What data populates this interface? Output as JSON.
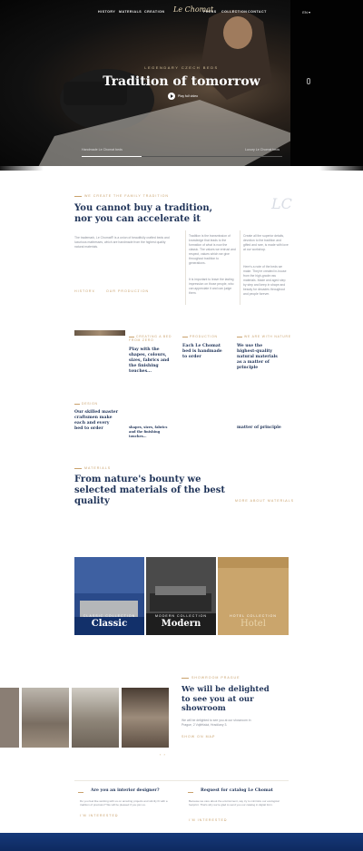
{
  "nav": {
    "items": [
      "HISTORY",
      "MATERIALS",
      "CREATION",
      "PRESS",
      "COLLECTION",
      "CONTACT"
    ],
    "logo": "Le Chomat",
    "language": "EN"
  },
  "hero": {
    "kicker": "LEGENDARY CZECH BEDS",
    "title": "Tradition of tomorrow",
    "play_label": "Play full video",
    "slide_left": "Handmade Le Chomat beds",
    "slide_right": "Luxury Le Chomat beds",
    "progress_fraction": 0.3
  },
  "intro": {
    "eyebrow": "WE CREATE THE FAMILY TRADITION",
    "title_line1": "You cannot buy a tradition,",
    "title_line2": "nor you can accelerate it",
    "lead": "The trademark, Le Chomat® is a union of beautifully crafted beds and luxurious mattresses, which are handmade from the highest quality natural materials.",
    "col2": "Tradition is the transmission of knowledge that leads to the formation of what is now the classic. The values we entrust and respect, values which we give throughout tradition to generations.",
    "col2b": "It is important to leave the lasting impression on those people, who can appreciate it and can judge them.",
    "col3": "Create all the superior details, devotion to the tradition and gifted and rare, is made with love at our workshop.",
    "col3b": "Here's a note of the beds we make. They're created in-house from the high-grade raw materials. Made and aged step by step and keep in shape and beauty for decades throughout and people forever.",
    "link1": "HISTORY",
    "link2": "OUR PRODUCTION",
    "monogram": "LC"
  },
  "features": [
    {
      "tag": "CREATING A BED FROM ZERO",
      "title": "Play with the shapes, colours, sizes, fabrics and the finishing touches..."
    },
    {
      "tag": "PRODUCTION",
      "title": "Each Le Chomat bed is handmade to order"
    },
    {
      "tag": "WE ARE WITH NATURE",
      "title": "We use the highest-quality natural materials as a matter of principle"
    },
    {
      "tag": "DESIGN",
      "title": "Our skilled master craftsmen make each and every bed to order"
    }
  ],
  "features_repeat": {
    "a": "shapes, sizes, fabrics and the finishing touches...",
    "b": "matter of principle"
  },
  "materials": {
    "eyebrow": "MATERIALS",
    "title_line1": "From nature's bounty we",
    "title_line2": "selected materials of the best",
    "title_line3": "quality",
    "link": "MORE ABOUT MATERIALS"
  },
  "collections": [
    {
      "label": "CLASSIC COLLECTION",
      "name": "Classic",
      "color": "#203c78"
    },
    {
      "label": "MODERN COLLECTION",
      "name": "Modern",
      "color": "#3a3a3a"
    },
    {
      "label": "HOTEL COLLECTION",
      "name": "Hotel",
      "color": "#c9a468"
    }
  ],
  "showroom": {
    "eyebrow": "SHOWROOM PRAGUE",
    "title_line1": "We will be delighted",
    "title_line2": "to see you at our",
    "title_line3": "showroom",
    "text": "We will be delighted to see you at our showroom in Prague, 2 Vojtěšská, Hradčany 3.",
    "link": "SHOW ON MAP"
  },
  "cta": [
    {
      "title": "Are you an interior designer?",
      "text": "Do you feel like working with us on amazing projects and strictly fit with a tradition of precision? We will be pleased if you join us.",
      "link": "I'M INTERESTED"
    },
    {
      "title": "Request for catalog Le Chomat",
      "text": "Because we care about the environment, say try to minimize our ecological footprint. That's why we're glad to send you our catalog in digital form.",
      "link": "I'M INTERESTED"
    }
  ]
}
